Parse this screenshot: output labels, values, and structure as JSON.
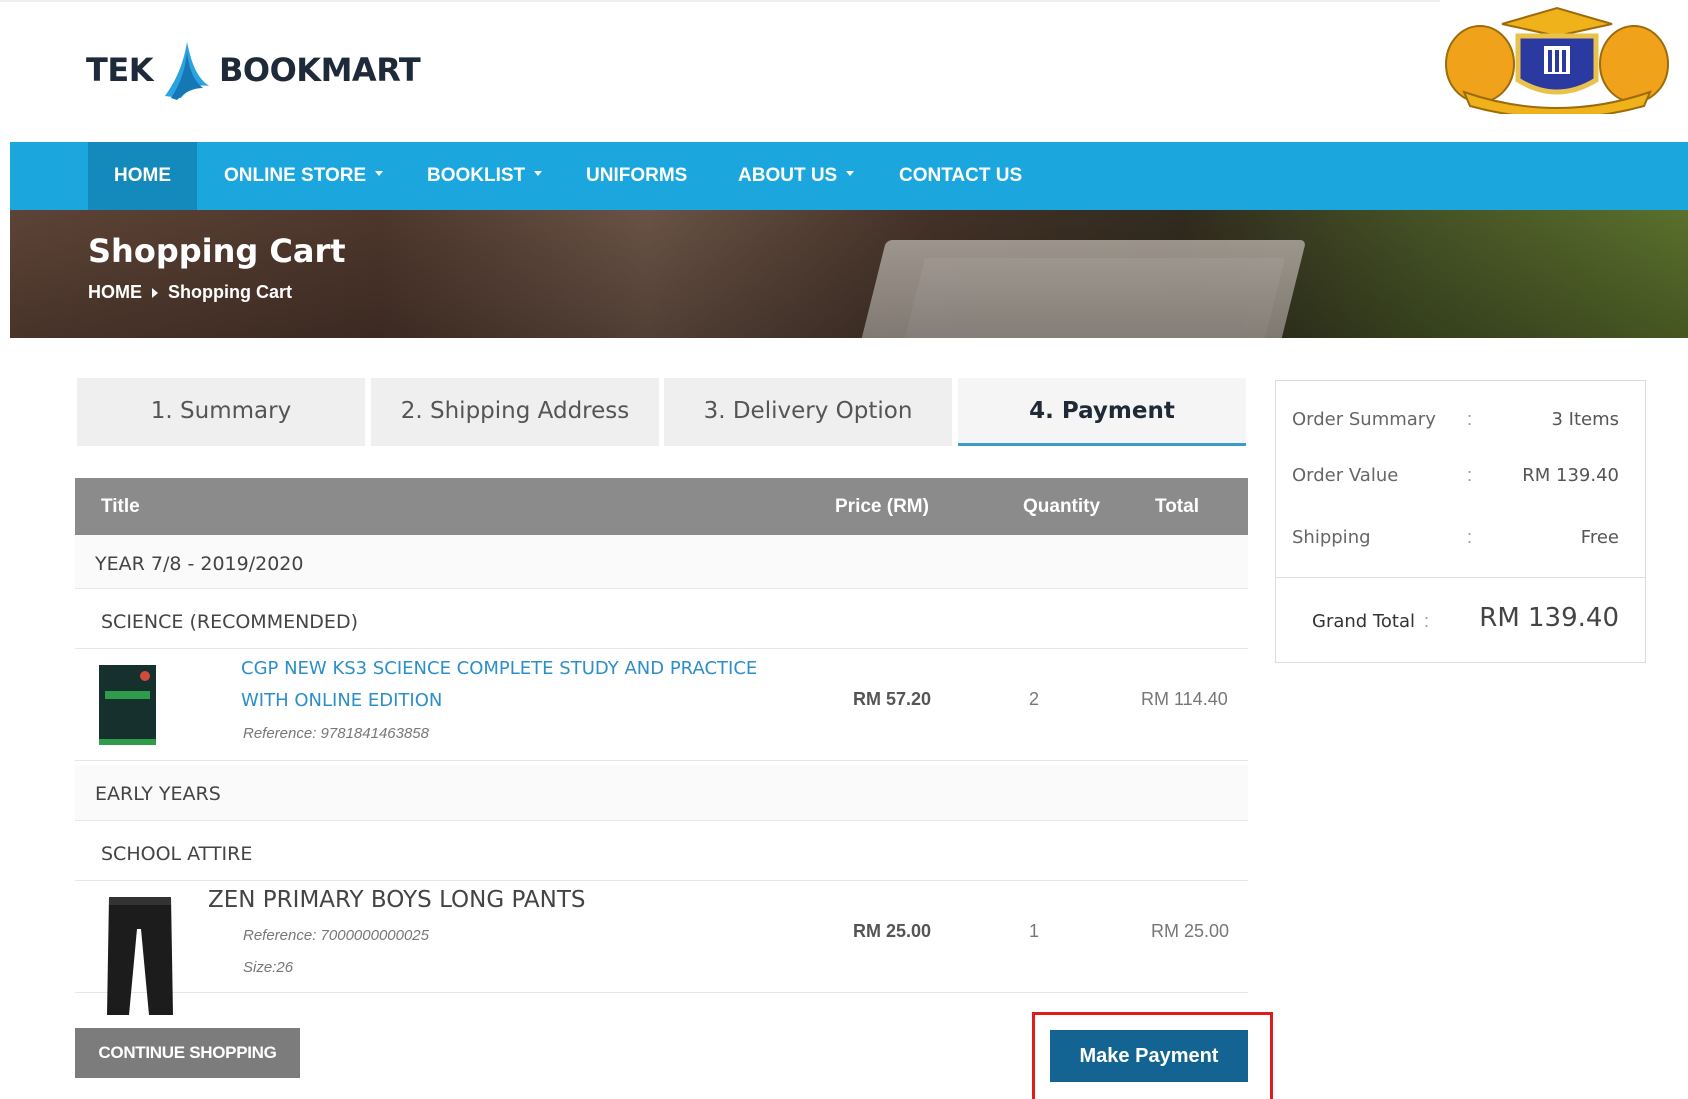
{
  "brand": {
    "logo_left": "TEK",
    "logo_right": "BOOKMART",
    "crest_icon": "school-crest-icon",
    "colors": {
      "nav": "#1ba6de",
      "nav_active": "#1489bb",
      "link": "#2d8fc7",
      "pay_button": "#146493",
      "highlight": "#e01b1b"
    }
  },
  "nav": {
    "items": [
      {
        "label": "HOME",
        "active": true
      },
      {
        "label": "ONLINE STORE",
        "dropdown": true
      },
      {
        "label": "BOOKLIST",
        "dropdown": true
      },
      {
        "label": "UNIFORMS"
      },
      {
        "label": "ABOUT US",
        "dropdown": true
      },
      {
        "label": "CONTACT US"
      }
    ]
  },
  "banner": {
    "title": "Shopping Cart",
    "breadcrumb": [
      "HOME",
      "Shopping Cart"
    ]
  },
  "steps": [
    {
      "label": "1. Summary"
    },
    {
      "label": "2. Shipping Address"
    },
    {
      "label": "3. Delivery Option"
    },
    {
      "label": "4. Payment",
      "active": true
    }
  ],
  "table": {
    "headers": {
      "title": "Title",
      "price": "Price (RM)",
      "quantity": "Quantity",
      "total": "Total"
    },
    "groups": [
      {
        "label": "YEAR 7/8 - 2019/2020"
      },
      {
        "label": "SCIENCE (RECOMMENDED)"
      },
      {
        "label": "EARLY YEARS"
      },
      {
        "label": "SCHOOL ATTIRE"
      }
    ],
    "items": [
      {
        "title_line1": "CGP NEW KS3 SCIENCE COMPLETE STUDY AND PRACTICE",
        "title_line2": "WITH ONLINE EDITION",
        "reference": "Reference: 9781841463858",
        "price": "RM 57.20",
        "quantity": "2",
        "total": "RM 114.40"
      },
      {
        "title": "ZEN PRIMARY BOYS LONG PANTS",
        "reference": "Reference: 7000000000025",
        "size": "Size:26",
        "price": "RM 25.00",
        "quantity": "1",
        "total": "RM 25.00"
      }
    ]
  },
  "actions": {
    "continue_label": "CONTINUE SHOPPING",
    "pay_label": "Make Payment"
  },
  "order_summary": {
    "rows": [
      {
        "label": "Order Summary",
        "colon": ":",
        "value": "3 Items"
      },
      {
        "label": "Order Value",
        "colon": ":",
        "value": "RM 139.40"
      },
      {
        "label": "Shipping",
        "colon": ":",
        "value": "Free"
      }
    ],
    "grand_total_label": "Grand Total",
    "grand_total_colon": ":",
    "grand_total_value": "RM 139.40"
  }
}
